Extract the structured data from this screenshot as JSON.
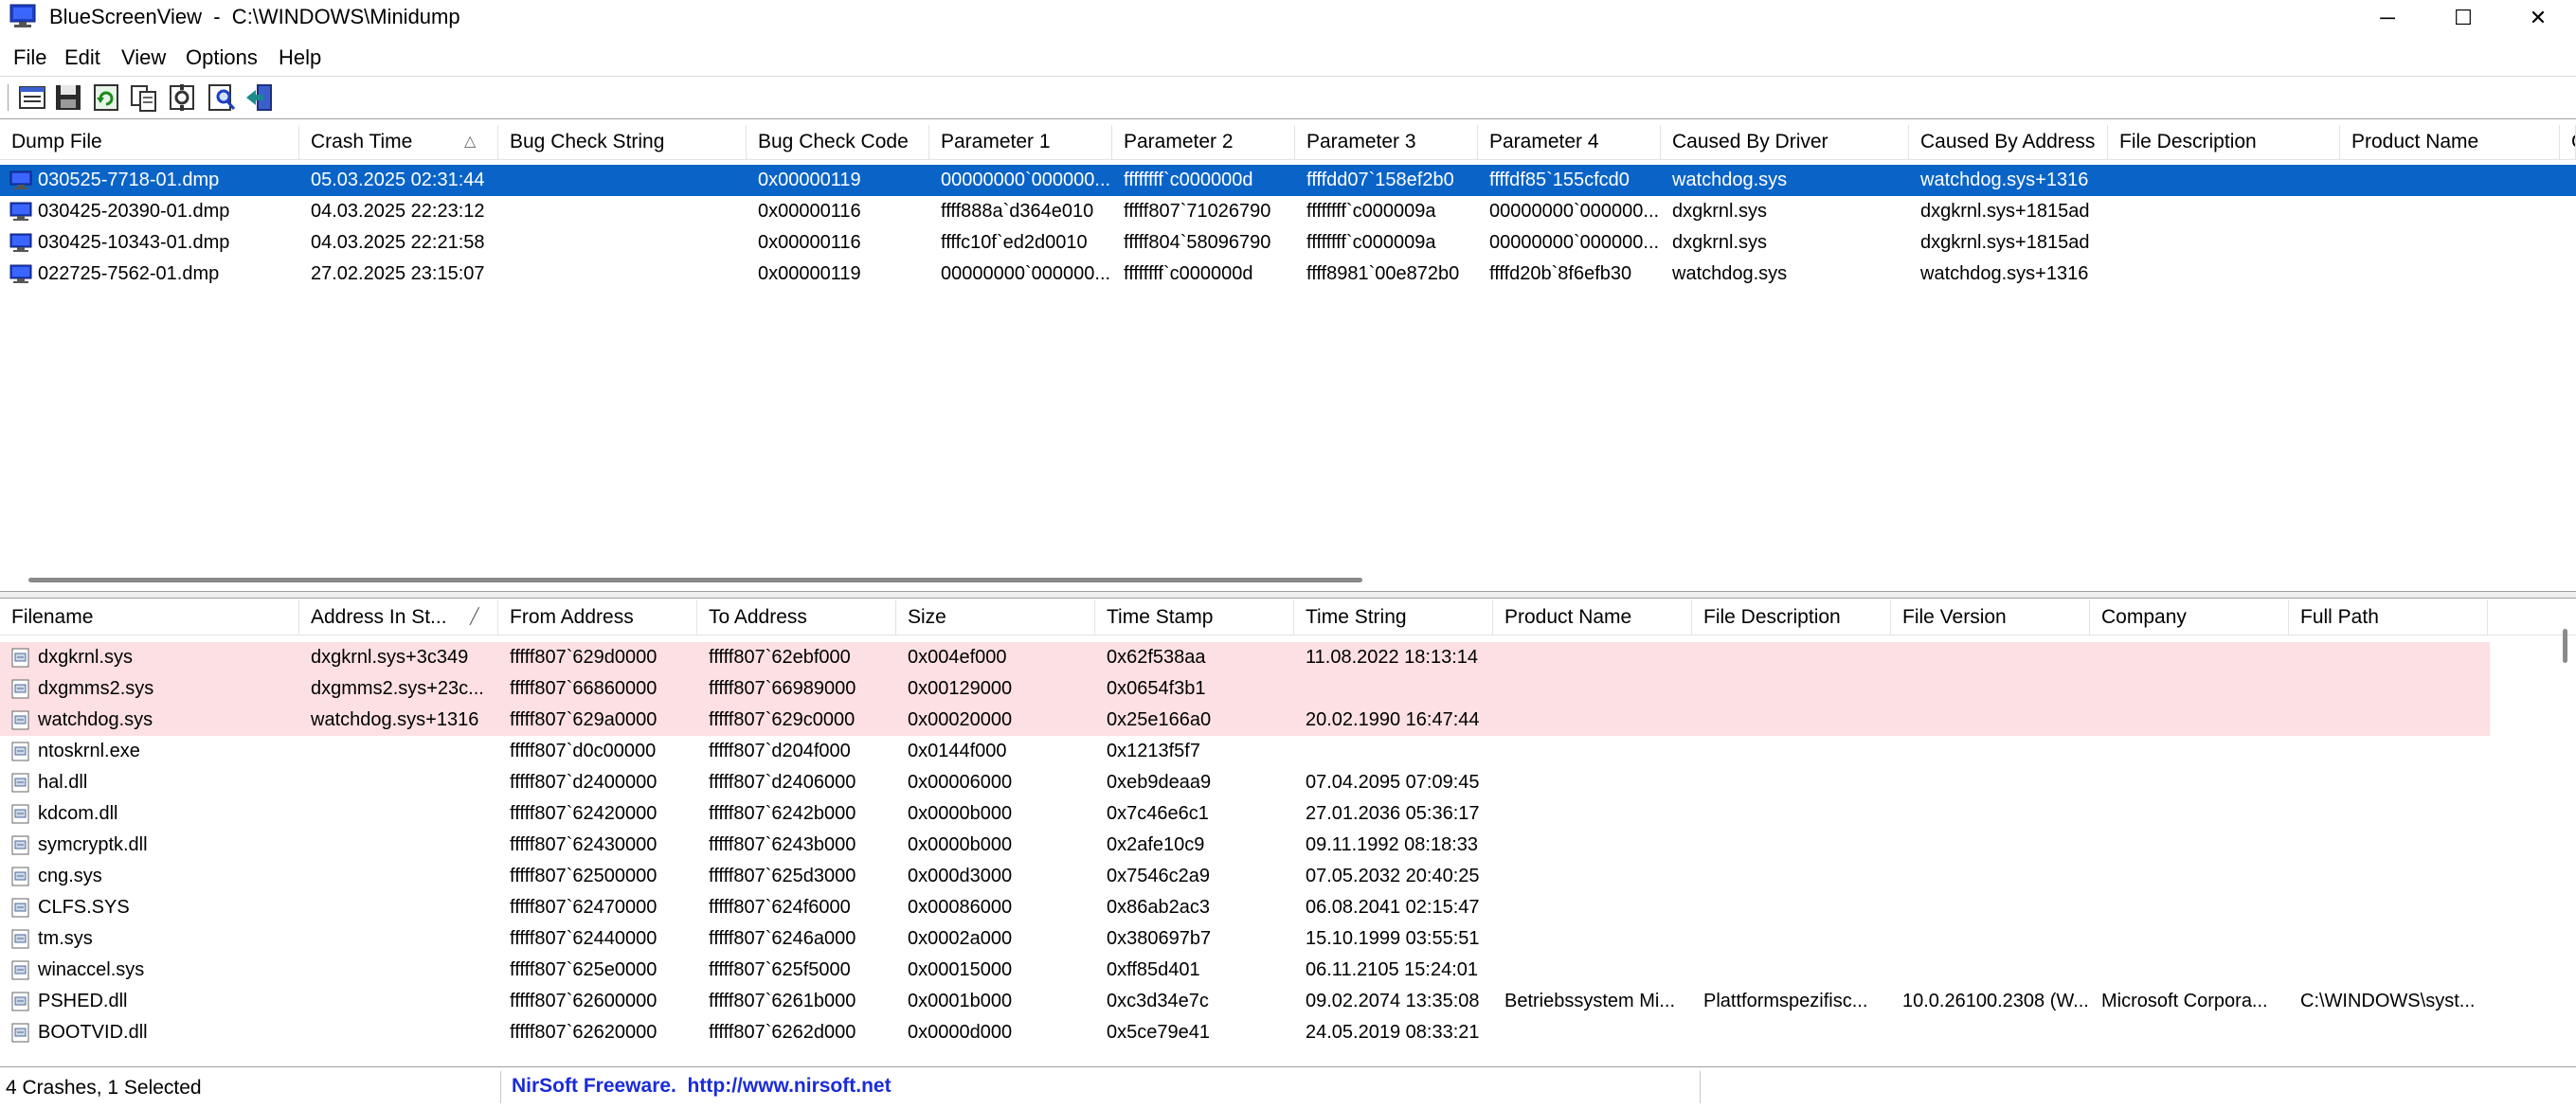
{
  "window": {
    "title": "BlueScreenView  -  C:\\WINDOWS\\Minidump",
    "minimize_glyph": "─",
    "maximize_glyph": "☐",
    "close_glyph": "✕"
  },
  "menu": [
    "File",
    "Edit",
    "View",
    "Options",
    "Help"
  ],
  "toolbar_icons": [
    "properties-icon",
    "save-icon",
    "refresh-icon",
    "copy-icon",
    "settings-icon",
    "find-icon",
    "exit-icon"
  ],
  "colors": {
    "selection": "#0a64c8",
    "highlight_row": "#fde0e3",
    "link": "#1a2cd8"
  },
  "crash_table": {
    "columns": [
      "Dump File",
      "Crash Time",
      "Bug Check String",
      "Bug Check Code",
      "Parameter 1",
      "Parameter 2",
      "Parameter 3",
      "Parameter 4",
      "Caused By Driver",
      "Caused By Address",
      "File Description",
      "Product Name",
      "C"
    ],
    "sort_column_index": 1,
    "sort_indicator": "△",
    "selected_row_index": 0,
    "rows": [
      [
        "030525-7718-01.dmp",
        "05.03.2025 02:31:44",
        "",
        "0x00000119",
        "00000000`000000...",
        "ffffffff`c000000d",
        "ffffdd07`158ef2b0",
        "ffffdf85`155cfcd0",
        "watchdog.sys",
        "watchdog.sys+1316",
        "",
        "",
        ""
      ],
      [
        "030425-20390-01.dmp",
        "04.03.2025 22:23:12",
        "",
        "0x00000116",
        "ffff888a`d364e010",
        "fffff807`71026790",
        "ffffffff`c000009a",
        "00000000`000000...",
        "dxgkrnl.sys",
        "dxgkrnl.sys+1815ad",
        "",
        "",
        ""
      ],
      [
        "030425-10343-01.dmp",
        "04.03.2025 22:21:58",
        "",
        "0x00000116",
        "ffffc10f`ed2d0010",
        "fffff804`58096790",
        "ffffffff`c000009a",
        "00000000`000000...",
        "dxgkrnl.sys",
        "dxgkrnl.sys+1815ad",
        "",
        "",
        ""
      ],
      [
        "022725-7562-01.dmp",
        "27.02.2025 23:15:07",
        "",
        "0x00000119",
        "00000000`000000...",
        "ffffffff`c000000d",
        "ffff8981`00e872b0",
        "ffffd20b`8f6efb30",
        "watchdog.sys",
        "watchdog.sys+1316",
        "",
        "",
        ""
      ]
    ]
  },
  "driver_table": {
    "columns": [
      "Filename",
      "Address In St...",
      "From Address",
      "To Address",
      "Size",
      "Time Stamp",
      "Time String",
      "Product Name",
      "File Description",
      "File Version",
      "Company",
      "Full Path"
    ],
    "sort_column_index": 1,
    "sort_indicator": "╱",
    "highlighted_row_count": 3,
    "rows": [
      [
        "dxgkrnl.sys",
        "dxgkrnl.sys+3c349",
        "fffff807`629d0000",
        "fffff807`62ebf000",
        "0x004ef000",
        "0x62f538aa",
        "11.08.2022 18:13:14",
        "",
        "",
        "",
        "",
        ""
      ],
      [
        "dxgmms2.sys",
        "dxgmms2.sys+23c...",
        "fffff807`66860000",
        "fffff807`66989000",
        "0x00129000",
        "0x0654f3b1",
        "",
        "",
        "",
        "",
        "",
        ""
      ],
      [
        "watchdog.sys",
        "watchdog.sys+1316",
        "fffff807`629a0000",
        "fffff807`629c0000",
        "0x00020000",
        "0x25e166a0",
        "20.02.1990 16:47:44",
        "",
        "",
        "",
        "",
        ""
      ],
      [
        "ntoskrnl.exe",
        "",
        "fffff807`d0c00000",
        "fffff807`d204f000",
        "0x0144f000",
        "0x1213f5f7",
        "",
        "",
        "",
        "",
        "",
        ""
      ],
      [
        "hal.dll",
        "",
        "fffff807`d2400000",
        "fffff807`d2406000",
        "0x00006000",
        "0xeb9deaa9",
        "07.04.2095 07:09:45",
        "",
        "",
        "",
        "",
        ""
      ],
      [
        "kdcom.dll",
        "",
        "fffff807`62420000",
        "fffff807`6242b000",
        "0x0000b000",
        "0x7c46e6c1",
        "27.01.2036 05:36:17",
        "",
        "",
        "",
        "",
        ""
      ],
      [
        "symcryptk.dll",
        "",
        "fffff807`62430000",
        "fffff807`6243b000",
        "0x0000b000",
        "0x2afe10c9",
        "09.11.1992 08:18:33",
        "",
        "",
        "",
        "",
        ""
      ],
      [
        "cng.sys",
        "",
        "fffff807`62500000",
        "fffff807`625d3000",
        "0x000d3000",
        "0x7546c2a9",
        "07.05.2032 20:40:25",
        "",
        "",
        "",
        "",
        ""
      ],
      [
        "CLFS.SYS",
        "",
        "fffff807`62470000",
        "fffff807`624f6000",
        "0x00086000",
        "0x86ab2ac3",
        "06.08.2041 02:15:47",
        "",
        "",
        "",
        "",
        ""
      ],
      [
        "tm.sys",
        "",
        "fffff807`62440000",
        "fffff807`6246a000",
        "0x0002a000",
        "0x380697b7",
        "15.10.1999 03:55:51",
        "",
        "",
        "",
        "",
        ""
      ],
      [
        "winaccel.sys",
        "",
        "fffff807`625e0000",
        "fffff807`625f5000",
        "0x00015000",
        "0xff85d401",
        "06.11.2105 15:24:01",
        "",
        "",
        "",
        "",
        ""
      ],
      [
        "PSHED.dll",
        "",
        "fffff807`62600000",
        "fffff807`6261b000",
        "0x0001b000",
        "0xc3d34e7c",
        "09.02.2074 13:35:08",
        "Betriebssystem Mi...",
        "Plattformspezifisc...",
        "10.0.26100.2308 (W...",
        "Microsoft Corpora...",
        "C:\\WINDOWS\\syst..."
      ],
      [
        "BOOTVID.dll",
        "",
        "fffff807`62620000",
        "fffff807`6262d000",
        "0x0000d000",
        "0x5ce79e41",
        "24.05.2019 08:33:21",
        "",
        "",
        "",
        "",
        ""
      ]
    ]
  },
  "status": {
    "summary": "4 Crashes, 1 Selected",
    "link_text": "NirSoft Freeware.  http://www.nirsoft.net"
  }
}
